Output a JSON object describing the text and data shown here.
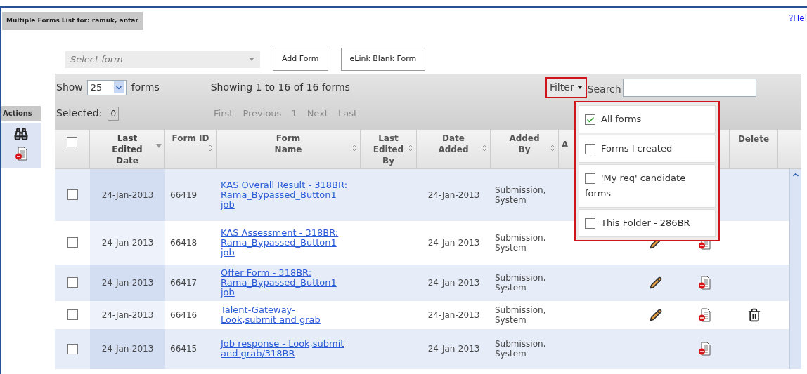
{
  "title": "Multiple Forms List for: ramuk, antar",
  "help_link": "?Hel",
  "sidebar": {
    "label": "Actions"
  },
  "form_select": {
    "placeholder": "Select form"
  },
  "buttons": [
    "Add Form",
    "eLink Blank Form"
  ],
  "toolbar": {
    "show_label": "Show",
    "page_size": "25",
    "forms_label": "forms",
    "showing": "Showing 1 to 16 of 16 forms",
    "selected_label": "Selected:",
    "selected_count": "0",
    "pager": [
      {
        "label": "First",
        "disabled": true
      },
      {
        "label": "Previous",
        "disabled": true
      },
      {
        "label": "1",
        "disabled": true
      },
      {
        "label": "Next",
        "disabled": true
      },
      {
        "label": "Last",
        "disabled": true
      }
    ],
    "filter_label": "Filter",
    "search_label": "Search"
  },
  "filter_menu": {
    "open": true,
    "options": [
      {
        "label": "All forms",
        "checked": true
      },
      {
        "label": "Forms I created",
        "checked": false
      },
      {
        "label": "'My req' candidate forms",
        "checked": false
      },
      {
        "label": "This Folder - 286BR",
        "checked": false
      }
    ]
  },
  "table": {
    "columns": [
      {
        "label": "Last Edited Date",
        "sortable": true,
        "sorted": true
      },
      {
        "label": "Form ID",
        "sortable": true,
        "sorted": false
      },
      {
        "label": "Form Name",
        "sortable": true,
        "sorted": false
      },
      {
        "label": "Last Edited By",
        "sortable": true,
        "sorted": false
      },
      {
        "label": "Date Added",
        "sortable": true,
        "sorted": false
      },
      {
        "label": "Added By",
        "sortable": true,
        "sorted": false
      },
      {
        "label": "A",
        "sortable": false,
        "sorted": false
      }
    ],
    "select_all_checked": false,
    "delete_header": "Delete",
    "rows": [
      {
        "checked": false,
        "last_edited_date": "24-Jan-2013",
        "form_id": "66419",
        "form_name": "KAS Overall Result - 318BR: Rama_Bypassed_Button1 job",
        "date_added": "24-Jan-2013",
        "added_by": "Submission, System",
        "edit": false,
        "eform": false,
        "delete": false
      },
      {
        "checked": false,
        "last_edited_date": "24-Jan-2013",
        "form_id": "66418",
        "form_name": "KAS Assessment - 318BR: Rama_Bypassed_Button1 job",
        "date_added": "24-Jan-2013",
        "added_by": "Submission, System",
        "edit": true,
        "eform": true,
        "delete": false
      },
      {
        "checked": false,
        "last_edited_date": "24-Jan-2013",
        "form_id": "66417",
        "form_name": "Offer Form - 318BR: Rama_Bypassed_Button1 job",
        "date_added": "24-Jan-2013",
        "added_by": "Submission, System",
        "edit": true,
        "eform": true,
        "delete": false
      },
      {
        "checked": false,
        "last_edited_date": "24-Jan-2013",
        "form_id": "66416",
        "form_name": "Talent-Gateway-Look,submit and grab",
        "date_added": "24-Jan-2013",
        "added_by": "Submission, System",
        "edit": true,
        "eform": true,
        "delete": true
      },
      {
        "checked": false,
        "last_edited_date": "24-Jan-2013",
        "form_id": "66415",
        "form_name": "Job response - Look,submit and grab/318BR",
        "date_added": "24-Jan-2013",
        "added_by": "Submission, System",
        "edit": false,
        "eform": true,
        "delete": false
      }
    ]
  }
}
